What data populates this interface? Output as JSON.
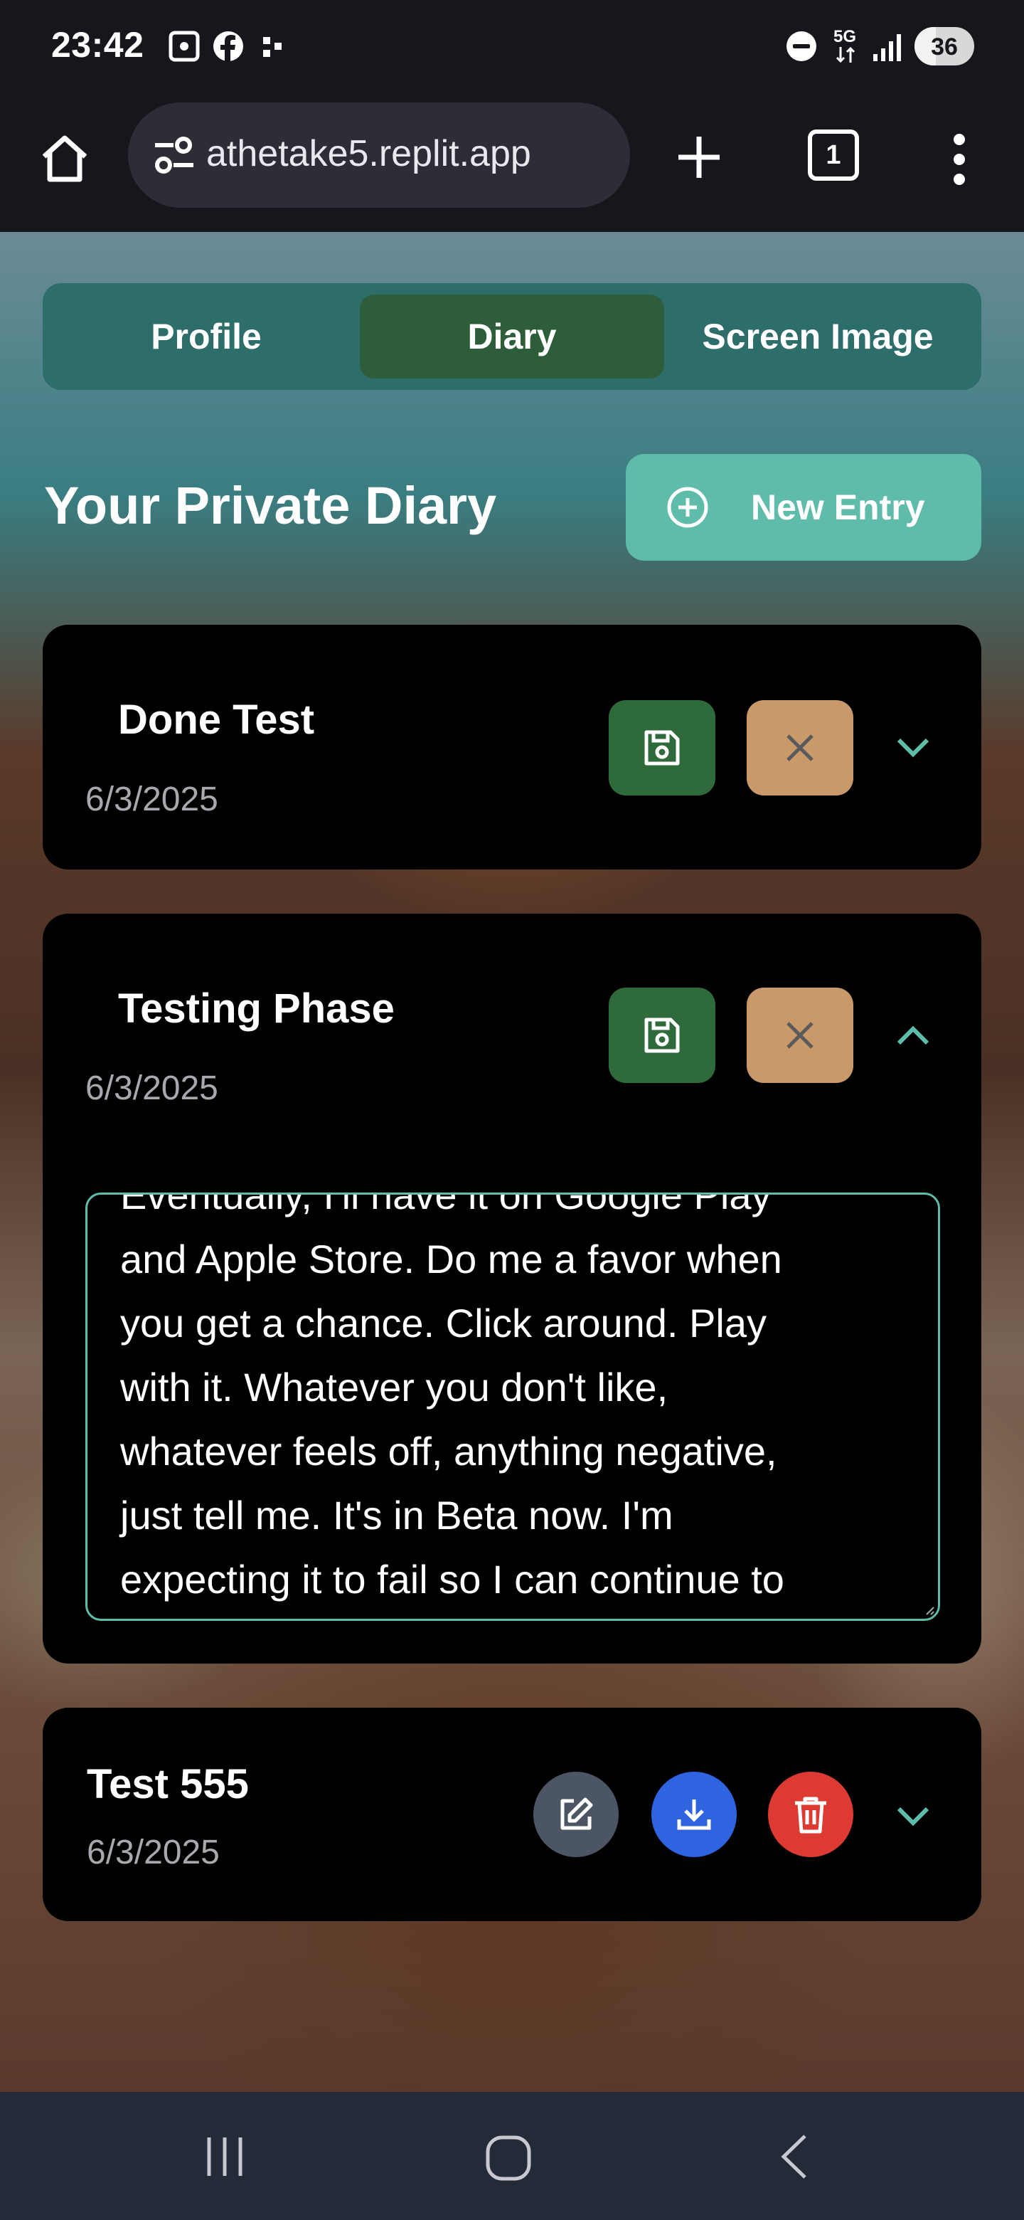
{
  "status_bar": {
    "time": "23:42",
    "network": "5G",
    "battery": "36"
  },
  "browser": {
    "url": "athetake5.replit.app",
    "tab_count": "1"
  },
  "tabs": [
    {
      "label": "Profile",
      "active": false
    },
    {
      "label": "Diary",
      "active": true
    },
    {
      "label": "Screen Image",
      "active": false
    }
  ],
  "page_title": "Your Private Diary",
  "new_entry_label": "New Entry",
  "entries": [
    {
      "title": "Done Test",
      "date": "6/3/2025",
      "mode": "editing",
      "expanded": false
    },
    {
      "title": "Testing Phase",
      "date": "6/3/2025",
      "mode": "editing",
      "expanded": true,
      "body_lines": [
        "Eventually, I'll have it on Google Play",
        "and Apple Store. Do me a favor when",
        "you get a chance. Click around. Play",
        "with it. Whatever you don't like,",
        "whatever feels off, anything negative,",
        "just tell me. It's in Beta now. I'm",
        "expecting it to fail so I can continue to"
      ]
    },
    {
      "title": "Test 555",
      "date": "6/3/2025",
      "mode": "view",
      "expanded": false
    }
  ],
  "colors": {
    "accent": "#5fbcaa",
    "tabs_bg": "#2d6e6a",
    "tab_active": "#2e5d3a",
    "save": "#2f6a3b",
    "cancel": "#c9996a",
    "edit": "#4b5563",
    "download": "#2f63e0",
    "delete": "#dc3a32"
  },
  "icons": [
    "home-icon",
    "site-settings-icon",
    "new-tab-icon",
    "tab-switcher-icon",
    "more-menu-icon",
    "plus-circle-icon",
    "save-icon",
    "close-icon",
    "chevron-down-icon",
    "chevron-up-icon",
    "edit-icon",
    "download-icon",
    "trash-icon"
  ]
}
